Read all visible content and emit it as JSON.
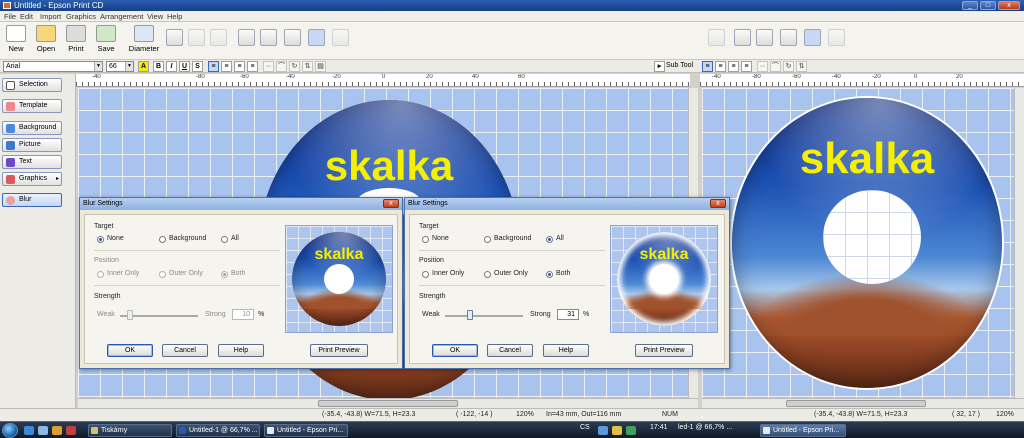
{
  "window": {
    "title": "Untitled - Epson Print CD",
    "min": "_",
    "max": "□",
    "close": "x"
  },
  "menu": [
    "File",
    "Edit",
    "Import",
    "Graphics",
    "Arrangement",
    "View",
    "Help"
  ],
  "toolbar": {
    "new": "New",
    "open": "Open",
    "print": "Print",
    "save": "Save",
    "diameter": "Diameter",
    "icons": [
      "new-file-icon",
      "open-folder-icon",
      "printer-icon",
      "save-icon",
      "diameter-icon"
    ]
  },
  "format": {
    "font": "Arial",
    "size": "66",
    "bold": "B",
    "italic": "I",
    "underline": "U",
    "shadow": "S",
    "subtool": "Sub Tool"
  },
  "ruler_left": [
    "-40",
    "-80",
    "-60",
    "-40",
    "-20",
    "0",
    "20",
    "40",
    "60"
  ],
  "ruler_right": [
    "-40",
    "-80",
    "-60",
    "-40",
    "-20",
    "0",
    "20"
  ],
  "sidebar": {
    "items": [
      "Selection",
      "Template",
      "Background",
      "Picture",
      "Text",
      "Graphics",
      "Blur"
    ]
  },
  "disc": {
    "text": "skalka"
  },
  "dialog_left": {
    "title": "Blur Settings",
    "target_label": "Target",
    "target_options": [
      "None",
      "Background",
      "All"
    ],
    "target_selected": "None",
    "position_label": "Position",
    "position_options": [
      "Inner Only",
      "Outer Only",
      "Both"
    ],
    "position_selected": "Both",
    "strength_label": "Strength",
    "weak": "Weak",
    "strong": "Strong",
    "value": "10",
    "unit": "%",
    "strength_level": 0.1,
    "ok": "OK",
    "cancel": "Cancel",
    "help": "Help",
    "preview": "Print Preview",
    "preview_text": "skalka"
  },
  "dialog_right": {
    "title": "Blur Settings",
    "target_label": "Target",
    "target_options": [
      "None",
      "Background",
      "All"
    ],
    "target_selected": "All",
    "position_label": "Position",
    "position_options": [
      "Inner Only",
      "Outer Only",
      "Both"
    ],
    "position_selected": "Both",
    "strength_label": "Strength",
    "weak": "Weak",
    "strong": "Strong",
    "value": "31",
    "unit": "%",
    "strength_level": 0.31,
    "ok": "OK",
    "cancel": "Cancel",
    "help": "Help",
    "preview": "Print Preview",
    "preview_text": "skalka"
  },
  "status": {
    "left_coords": "(-35.4, -43.8) W=71.5, H=23.3",
    "left_pos": "( -122, -14 )",
    "left_zoom": "120%",
    "size_info": "In=43 mm, Out=116 mm",
    "num": "NUM",
    "right_coords": "(-35.4, -43.8) W=71.5, H=23.3",
    "right_pos": "( 32, 17 )",
    "right_zoom": "120%"
  },
  "taskbar": {
    "tasks": [
      "Tiskárny",
      "Untitled-1 @ 66,7% ...",
      "Untitled - Epson Pri...",
      "Untitled - Epson Pri..."
    ],
    "lang": "CS",
    "clock": "17:41",
    "tray_task": "led-1 @ 66,7% ..."
  }
}
